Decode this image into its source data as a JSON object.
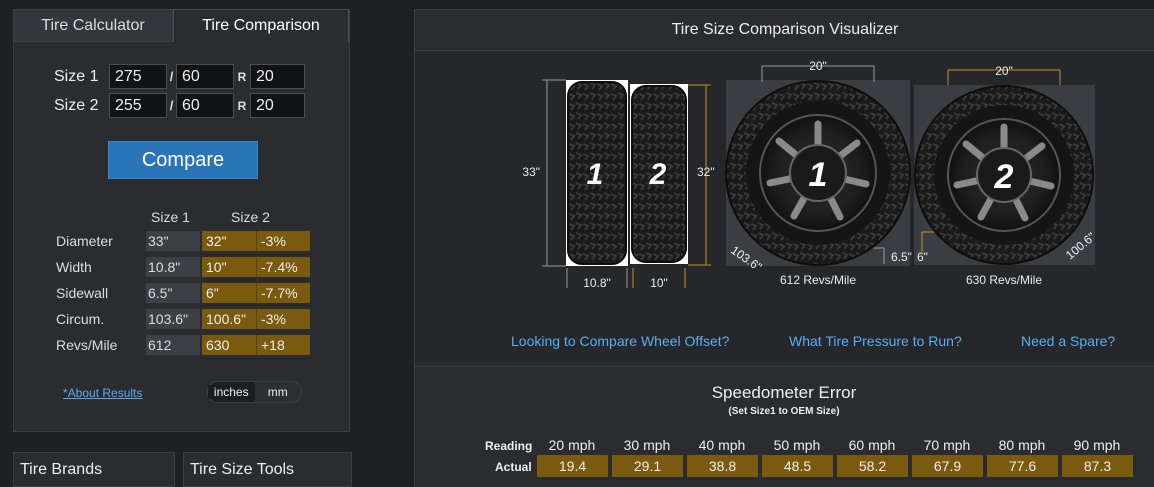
{
  "tabs": {
    "calculator": "Tire Calculator",
    "comparison": "Tire Comparison"
  },
  "inputs": {
    "size1_label": "Size 1",
    "size2_label": "Size 2",
    "size1": {
      "width": "275",
      "aspect": "60",
      "rim": "20"
    },
    "size2": {
      "width": "255",
      "aspect": "60",
      "rim": "20"
    },
    "slash": "/",
    "r": "R"
  },
  "compare_button": "Compare",
  "results": {
    "col1": "Size 1",
    "col2": "Size 2",
    "rows": [
      {
        "label": "Diameter",
        "s1": "33\"",
        "s2": "32\"",
        "diff": "-3%"
      },
      {
        "label": "Width",
        "s1": "10.8\"",
        "s2": "10\"",
        "diff": "-7.4%"
      },
      {
        "label": "Sidewall",
        "s1": "6.5\"",
        "s2": "6\"",
        "diff": "-7.7%"
      },
      {
        "label": "Circum.",
        "s1": "103.6\"",
        "s2": "100.6\"",
        "diff": "-3%"
      },
      {
        "label": "Revs/Mile",
        "s1": "612",
        "s2": "630",
        "diff": "+18"
      }
    ]
  },
  "about_link": "*About Results",
  "units": {
    "inches": "inches",
    "mm": "mm"
  },
  "bottom": {
    "brands": "Tire Brands",
    "tools": "Tire Size Tools"
  },
  "visualizer": {
    "title": "Tire Size Comparison Visualizer",
    "tire1_num": "1",
    "tire2_num": "2",
    "dia1": "33\"",
    "dia2": "32\"",
    "width1": "10.8\"",
    "width2": "10\"",
    "rim1": "20\"",
    "rim2": "20\"",
    "side1": "6.5\"",
    "side2": "6\"",
    "circ1": "103.6\"",
    "circ2": "100.6\"",
    "revs1": "612 Revs/Mile",
    "revs2": "630 Revs/Mile",
    "colors": {
      "size1": "#9a9a9a",
      "size2": "#c8901a"
    }
  },
  "links": {
    "offset": "Looking to Compare Wheel Offset?",
    "pressure": "What Tire Pressure to Run?",
    "spare": "Need a Spare?"
  },
  "speedo": {
    "title": "Speedometer Error",
    "subtitle": "(Set Size1 to OEM Size)",
    "reading_label": "Reading",
    "actual_label": "Actual",
    "readings": [
      "20 mph",
      "30 mph",
      "40 mph",
      "50 mph",
      "60 mph",
      "70 mph",
      "80 mph",
      "90 mph"
    ],
    "actuals": [
      "19.4",
      "29.1",
      "38.8",
      "48.5",
      "58.2",
      "67.9",
      "77.6",
      "87.3"
    ]
  }
}
